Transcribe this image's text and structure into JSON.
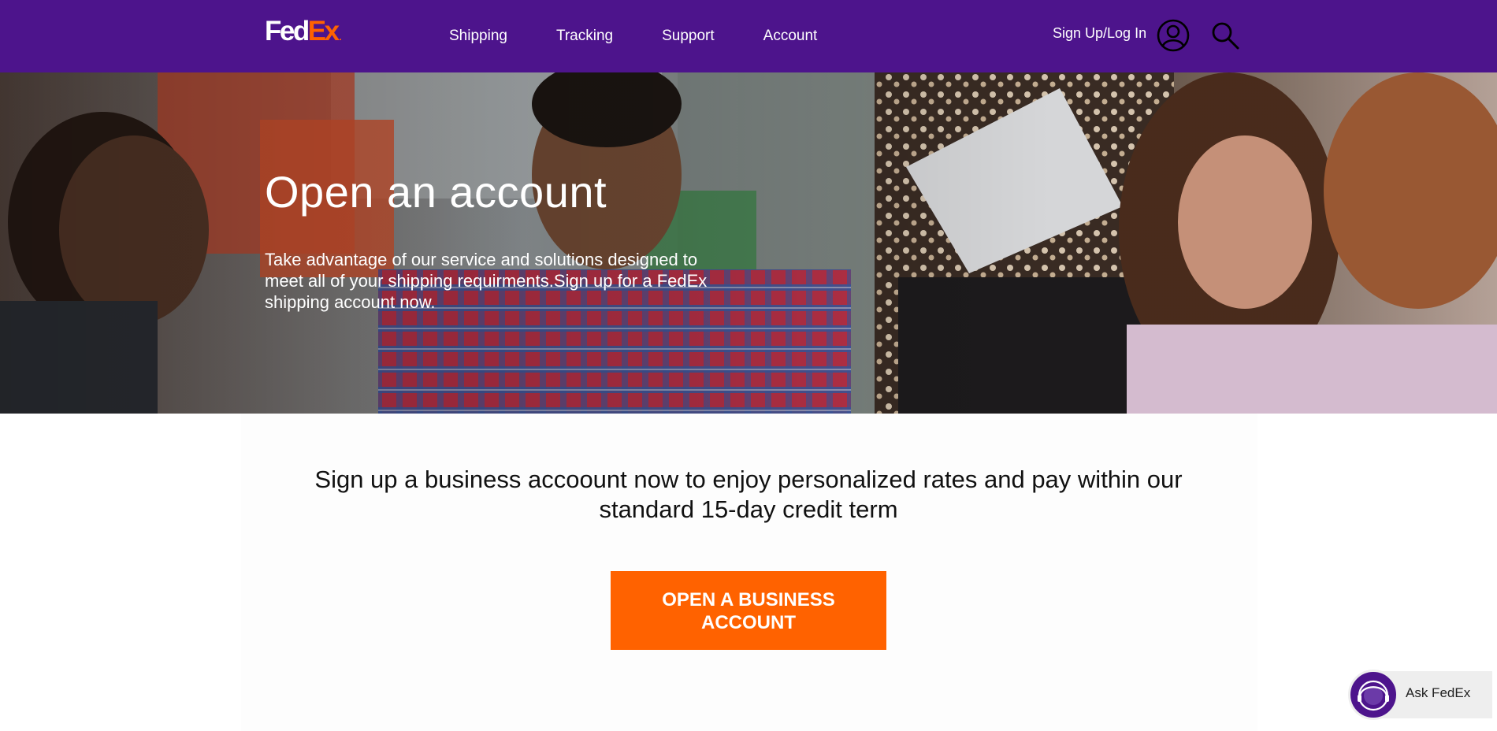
{
  "header": {
    "logo": {
      "fed": "Fed",
      "ex": "Ex",
      "dot": "."
    },
    "nav": [
      {
        "label": "Shipping"
      },
      {
        "label": "Tracking"
      },
      {
        "label": "Support"
      },
      {
        "label": "Account"
      }
    ],
    "signin_label": "Sign Up/Log In",
    "icons": {
      "account": "account-icon",
      "search": "search-icon"
    }
  },
  "hero": {
    "title": "Open an account",
    "description": "Take advantage of our service and solutions designed to meet all of your shipping requirments.Sign up for a FedEx shipping account now."
  },
  "content": {
    "promo": "Sign up a business accoount now to enjoy personalized rates and pay within our standard 15-day credit term",
    "cta_label": "OPEN A BUSINESS ACCOUNT"
  },
  "chat": {
    "label": "Ask FedEx",
    "icon": "support-agent-icon"
  },
  "colors": {
    "brand_purple": "#4d148c",
    "brand_orange": "#ff6200"
  }
}
